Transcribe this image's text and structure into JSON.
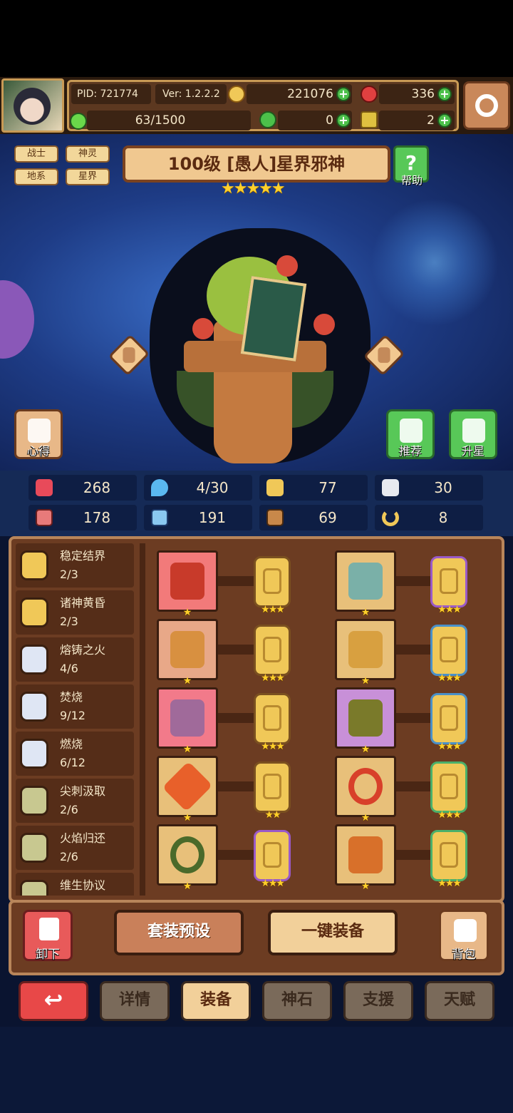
{
  "header": {
    "pid": "PID: 721774",
    "version": "Ver: 1.2.2.2",
    "gold": "221076",
    "ruby": "336",
    "energy": "63/1500",
    "clover": "0",
    "key": "2"
  },
  "hero": {
    "tags": [
      "战士",
      "神灵",
      "地系",
      "星界"
    ],
    "title": "100级  [愚人]星界邪神",
    "stars": "★★★★★",
    "help_label": "帮助",
    "insight_label": "心得",
    "recommend_label": "推荐",
    "upgrade_label": "升星"
  },
  "stats": [
    {
      "icon": "heart-icon",
      "value": "268"
    },
    {
      "icon": "mana-drop-icon",
      "value": "4/30"
    },
    {
      "icon": "shield-icon",
      "value": "77"
    },
    {
      "icon": "wing-icon",
      "value": "30"
    },
    {
      "icon": "fist-icon",
      "value": "178"
    },
    {
      "icon": "book-icon",
      "value": "191"
    },
    {
      "icon": "armor-icon",
      "value": "69"
    },
    {
      "icon": "horseshoe-icon",
      "value": "8"
    }
  ],
  "sets": [
    {
      "name": "稳定结界",
      "count": "2/3"
    },
    {
      "name": "诸神黄昏",
      "count": "2/3"
    },
    {
      "name": "熔铸之火",
      "count": "4/6"
    },
    {
      "name": "焚烧",
      "count": "9/12"
    },
    {
      "name": "燃烧",
      "count": "6/12"
    },
    {
      "name": "尖刺汲取",
      "count": "2/6"
    },
    {
      "name": "火焰归还",
      "count": "2/6"
    },
    {
      "name": "维生协议",
      "count": ""
    }
  ],
  "equipment": [
    {
      "slot_stars": "★",
      "rune_stars": "★★★"
    },
    {
      "slot_stars": "★",
      "rune_stars": "★★★"
    },
    {
      "slot_stars": "★",
      "rune_stars": "★★★"
    },
    {
      "slot_stars": "★",
      "rune_stars": "★★★"
    },
    {
      "slot_stars": "★",
      "rune_stars": "★★★"
    },
    {
      "slot_stars": "★",
      "rune_stars": "★★★"
    },
    {
      "slot_stars": "★",
      "rune_stars": "★★"
    },
    {
      "slot_stars": "★",
      "rune_stars": "★★★"
    },
    {
      "slot_stars": "★",
      "rune_stars": "★★★"
    },
    {
      "slot_stars": "★",
      "rune_stars": "★★★"
    }
  ],
  "actions": {
    "unload": "卸下",
    "preset": "套装预设",
    "equip_all": "一键装备",
    "bag": "背包"
  },
  "tabs": {
    "back": "↩",
    "details": "详情",
    "equip": "装备",
    "godstone": "神石",
    "support": "支援",
    "talent": "天赋"
  },
  "colors": {
    "gold": "#f0c858",
    "ruby": "#e04040",
    "green": "#4cc04a",
    "panel": "#6c3c22",
    "space": "#1e3c86"
  }
}
